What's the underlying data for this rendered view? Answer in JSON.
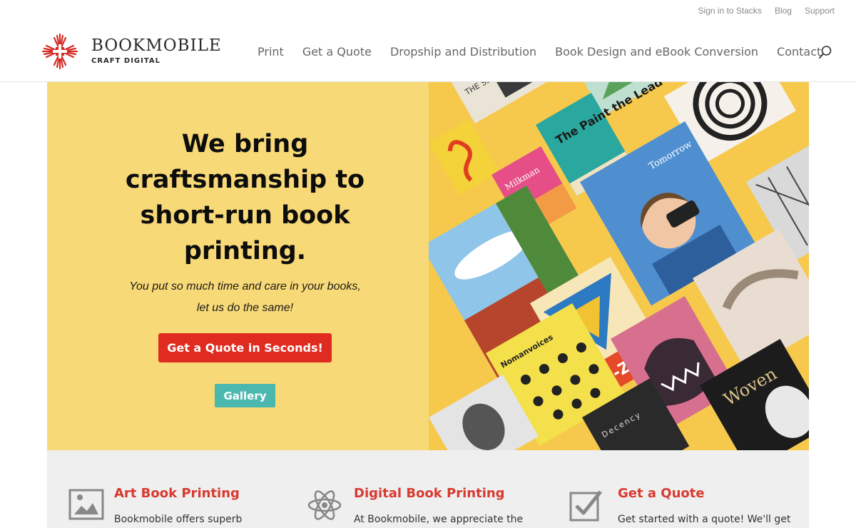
{
  "topbar": {
    "links": [
      "Sign in to Stacks",
      "Blog",
      "Support"
    ]
  },
  "logo": {
    "title": "BOOKMOBILE",
    "subtitle": "CRAFT DIGITAL"
  },
  "nav": {
    "items": [
      "Print",
      "Get a Quote",
      "Dropship and Distribution",
      "Book Design and eBook Conversion",
      "Contact"
    ]
  },
  "search": {
    "icon": "search-icon"
  },
  "hero": {
    "title": "We bring craftsmanship to short-run book printing.",
    "subtitle_line1": "You put so much time and care in your books,",
    "subtitle_line2": "let us do the same!",
    "quote_button": "Get a Quote in Seconds!",
    "gallery_button": "Gallery",
    "background_color": "#f8d977",
    "book_covers": [
      "Tomorrow",
      "OO-Z'OO",
      "Milkman",
      "The Paint the Lead",
      "Nomanvoices",
      "Woven",
      "Decency"
    ]
  },
  "features": [
    {
      "icon": "image-icon",
      "title": "Art Book Printing",
      "text": "Bookmobile offers superb"
    },
    {
      "icon": "atom-icon",
      "title": "Digital Book Printing",
      "text": "At Bookmobile, we appreciate the"
    },
    {
      "icon": "checkbox-icon",
      "title": "Get a Quote",
      "text": "Get started with a quote! We'll get"
    }
  ],
  "colors": {
    "accent_red": "#e02b20",
    "teal": "#4bb8b0",
    "feature_title": "#d9392f",
    "hero_yellow": "#f8d977"
  }
}
